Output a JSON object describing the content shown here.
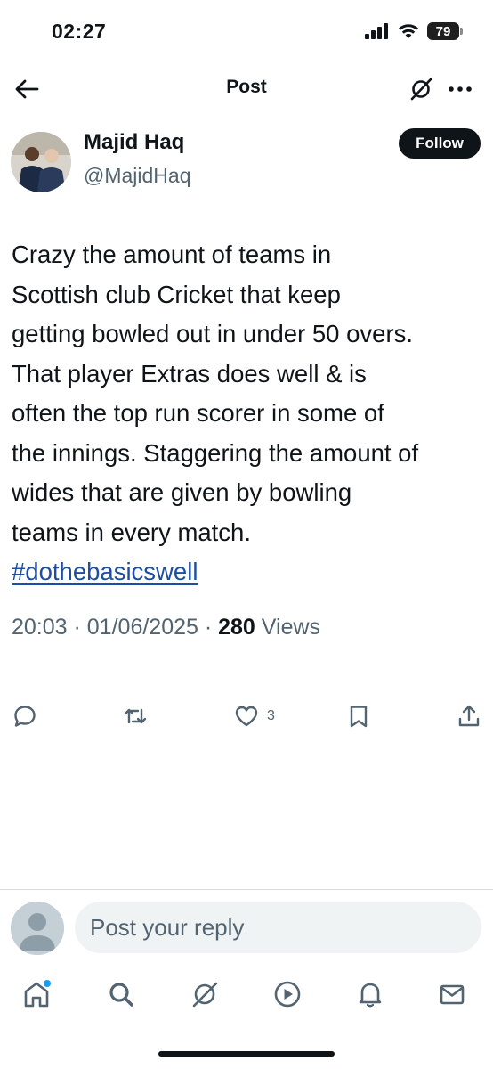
{
  "status_bar": {
    "time": "02:27",
    "battery": "79"
  },
  "nav": {
    "title": "Post"
  },
  "author": {
    "name": "Majid Haq",
    "handle": "@MajidHaq",
    "follow_label": "Follow"
  },
  "post": {
    "lines": [
      "Crazy the amount of teams in",
      "Scottish club Cricket that keep",
      "getting bowled out in under 50 overs.",
      "That player Extras does well & is",
      "often the top run scorer in some of",
      "the innings. Staggering the amount of",
      "wides that are given by bowling",
      "teams in every match."
    ],
    "hashtag": "#dothebasicswell",
    "time": "20:03",
    "date": "01/06/2025",
    "views_count": "280",
    "views_label": "Views"
  },
  "actions": {
    "like_count": "3"
  },
  "reply": {
    "placeholder": "Post your reply"
  },
  "icons": {
    "back": "back-arrow-icon",
    "grok": "grok-icon",
    "more": "more-icon",
    "reply": "reply-icon",
    "repost": "repost-icon",
    "like": "heart-icon",
    "bookmark": "bookmark-icon",
    "share": "share-icon",
    "home": "home-icon",
    "search": "search-icon",
    "grok_tab": "grok-icon",
    "video": "play-icon",
    "notifications": "bell-icon",
    "messages": "mail-icon"
  },
  "colors": {
    "accent": "#1d9bf0",
    "hashtag": "#1d4ea3",
    "text": "#0f1419",
    "secondary": "#536471"
  }
}
